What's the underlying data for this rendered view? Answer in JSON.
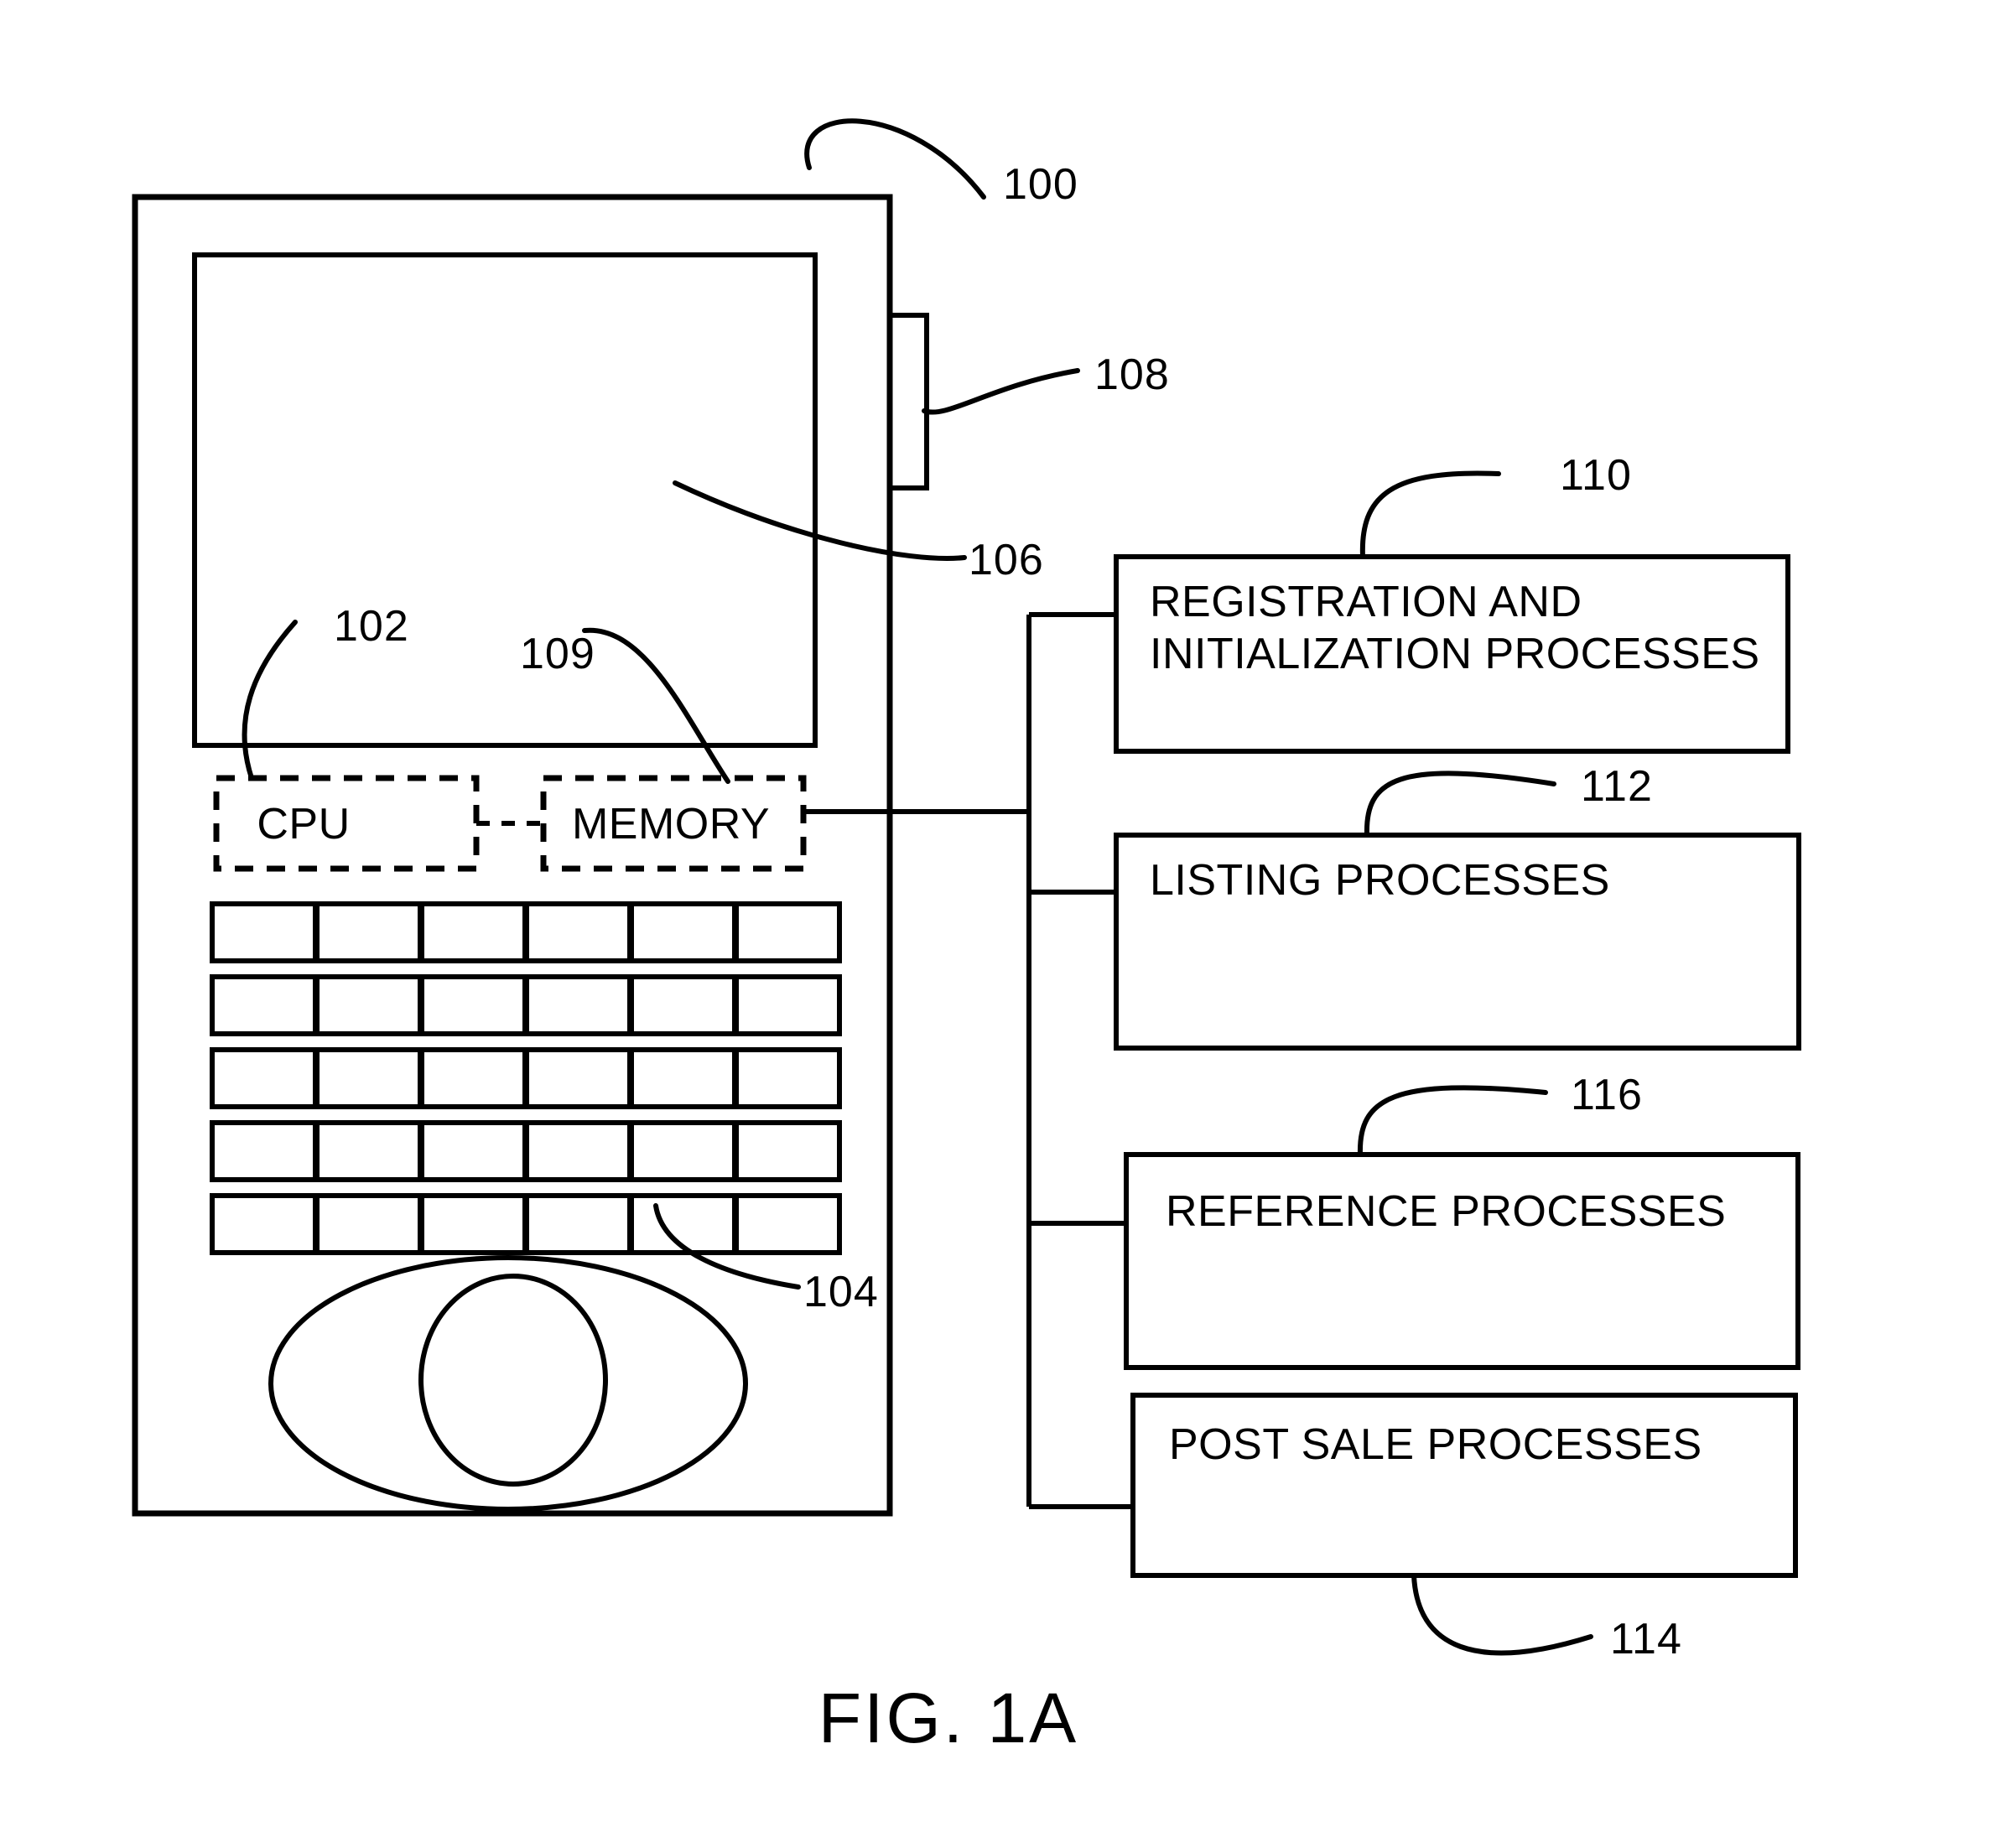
{
  "figure": {
    "caption": "FIG. 1A",
    "title": "FIG. 1A"
  },
  "device": {
    "reference_numeral": "100",
    "screen": {
      "reference_numeral": "106"
    },
    "side_button": {
      "reference_numeral": "108"
    },
    "keypad": {
      "reference_numeral": "104",
      "rows": 5,
      "columns": 6
    },
    "navigation_pad": {
      "name": "oval-navigation-pad"
    },
    "cpu": {
      "label": "CPU",
      "reference_numeral": "102"
    },
    "memory": {
      "label": "MEMORY",
      "reference_numeral": "109"
    }
  },
  "process_boxes": [
    {
      "id": "registration",
      "lines": [
        "REGISTRATION AND",
        "INITIALIZATION PROCESSES"
      ],
      "label": "REGISTRATION AND INITIALIZATION PROCESSES",
      "reference_numeral": "110"
    },
    {
      "id": "listing",
      "lines": [
        "LISTING PROCESSES"
      ],
      "label": "LISTING PROCESSES",
      "reference_numeral": "112"
    },
    {
      "id": "reference",
      "lines": [
        "REFERENCE PROCESSES"
      ],
      "label": "REFERENCE PROCESSES",
      "reference_numeral": "116"
    },
    {
      "id": "post_sale",
      "lines": [
        "POST SALE PROCESSES"
      ],
      "label": "POST SALE PROCESSES",
      "reference_numeral": "114"
    }
  ],
  "reference_numerals": {
    "device": "100",
    "cpu": "102",
    "keypad": "104",
    "screen": "106",
    "side_button": "108",
    "memory": "109",
    "registration": "110",
    "listing": "112",
    "post_sale": "114",
    "reference": "116"
  },
  "colors": {
    "ink": "#000000",
    "paper": "#ffffff"
  }
}
